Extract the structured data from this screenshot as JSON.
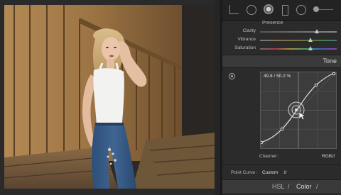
{
  "toolbar": {
    "icons": [
      "crop-icon",
      "spot-removal-icon",
      "red-eye-icon",
      "graduated-filter-icon",
      "radial-filter-icon",
      "brush-slider-icon"
    ]
  },
  "basic": {
    "section_title": "Presence",
    "sliders": [
      {
        "label": "Clarity",
        "value_fraction": 0.74
      },
      {
        "label": "Vibrance",
        "value_fraction": 0.66
      },
      {
        "label": "Saturation",
        "value_fraction": 0.66
      }
    ]
  },
  "tone_curve": {
    "header": "Tone",
    "readout": "49.8 / 50.2 %",
    "channel_label": "Channel :",
    "channel_value": "RGB",
    "point_curve_label": "Point Curve :",
    "point_curve_value": "Custom"
  },
  "hsl_tabs": [
    "HSL",
    "/",
    "Color",
    "/"
  ],
  "colors": {
    "panel_bg": "#2b2b2b",
    "curve_bg": "#3c3c3c",
    "accent_text": "#d6d6d6"
  }
}
